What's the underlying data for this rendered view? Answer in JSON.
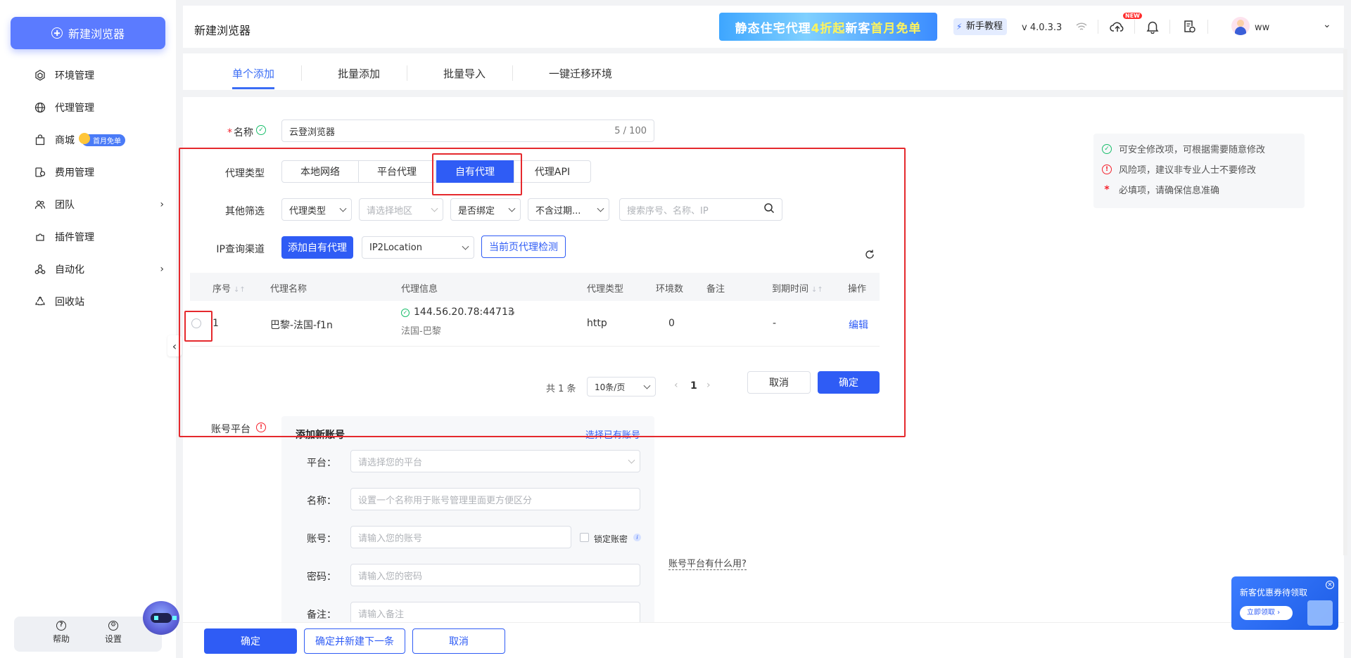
{
  "sidebar": {
    "new_browser_label": "新建浏览器",
    "items": [
      {
        "label": "环境管理",
        "icon": "cube-icon"
      },
      {
        "label": "代理管理",
        "icon": "globe-icon"
      },
      {
        "label": "商城",
        "icon": "bag-icon",
        "badge": "首月免单"
      },
      {
        "label": "费用管理",
        "icon": "coins-icon"
      },
      {
        "label": "团队",
        "icon": "team-icon"
      },
      {
        "label": "插件管理",
        "icon": "puzzle-icon"
      },
      {
        "label": "自动化",
        "icon": "automation-icon"
      },
      {
        "label": "回收站",
        "icon": "recycle-icon"
      }
    ],
    "footer": {
      "help": "帮助",
      "settings": "设置"
    }
  },
  "header": {
    "title": "新建浏览器",
    "promo": {
      "p1": "静态住宅代理",
      "p2": "4折起",
      "p3": " 新客",
      "p4": "首月免单"
    },
    "tutorial": "新手教程",
    "version": "v 4.0.3.3",
    "new_tag": "NEW",
    "user": "ww"
  },
  "tabs": [
    "单个添加",
    "批量添加",
    "批量导入",
    "一键迁移环境"
  ],
  "form": {
    "name_label": "名称",
    "name_value": "云登浏览器",
    "name_count": "5 / 100",
    "proxy_type_label": "代理类型",
    "proxy_types": [
      "本地网络",
      "平台代理",
      "自有代理",
      "代理API"
    ],
    "filter_label": "其他筛选",
    "filters": {
      "type": "代理类型",
      "region_placeholder": "请选择地区",
      "bound": "是否绑定",
      "expire": "不含过期...",
      "search_placeholder": "搜索序号、名称、IP"
    },
    "ip_channel_label": "IP查询渠道",
    "add_own_proxy": "添加自有代理",
    "ip_channel_value": "IP2Location",
    "check_current": "当前页代理检测",
    "table": {
      "headers": [
        "序号",
        "代理名称",
        "代理信息",
        "代理类型",
        "环境数",
        "备注",
        "到期时间",
        "操作"
      ],
      "rows": [
        {
          "index": "1",
          "name": "巴黎-法国-f1n",
          "ip": "144.56.20.78:44713",
          "location": "法国-巴黎",
          "type": "http",
          "env_count": "0",
          "note": "",
          "expire": "-",
          "action": "编辑"
        }
      ]
    },
    "pagination": {
      "total": "共 1 条",
      "page_size": "10条/页",
      "page": "1"
    },
    "cancel": "取消",
    "confirm": "确定",
    "account_label": "账号平台",
    "account": {
      "title": "添加新账号",
      "select_existing": "选择已有账号",
      "platform_label": "平台：",
      "platform_placeholder": "请选择您的平台",
      "name_label": "名称：",
      "name_placeholder": "设置一个名称用于账号管理里面更方便区分",
      "account_label": "账号：",
      "account_placeholder": "请输入您的账号",
      "lock_label": "锁定账密",
      "password_label": "密码：",
      "password_placeholder": "请输入您的密码",
      "note_label": "备注：",
      "note_placeholder": "请输入备注"
    },
    "account_help": "账号平台有什么用?"
  },
  "legend": [
    {
      "text": "可安全修改项，可根据需要随意修改",
      "color": "#19be6b"
    },
    {
      "text": "风险项，建议非专业人士不要修改",
      "color": "#f5222d"
    },
    {
      "text": "必填项，请确保信息准确",
      "color": "#f5222d"
    }
  ],
  "bottom": {
    "confirm": "确定",
    "confirm_next": "确定并新建下一条",
    "cancel": "取消"
  },
  "coupon": {
    "title": "新客优惠券待领取",
    "button": "立即领取"
  },
  "colors": {
    "primary": "#2f5cf5",
    "highlight_box": "#e5292d",
    "sidebar_button": "#5b7bff"
  }
}
